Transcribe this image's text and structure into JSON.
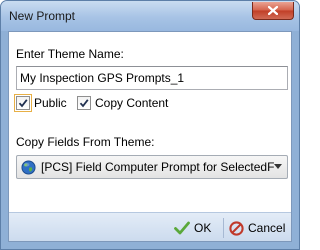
{
  "window": {
    "title": "New Prompt",
    "close_icon": "close-x-icon"
  },
  "form": {
    "theme_name_label": "Enter Theme Name:",
    "theme_name_value": "My Inspection GPS Prompts_1",
    "public_label": "Public",
    "public_checked": true,
    "copy_content_label": "Copy Content",
    "copy_content_checked": true,
    "copy_fields_label": "Copy Fields From Theme:",
    "copy_fields_selected": "[PCS] Field Computer Prompt for SelectedF",
    "combo_icon": "globe-icon"
  },
  "footer": {
    "ok_label": "OK",
    "cancel_label": "Cancel"
  },
  "colors": {
    "frame": "#8fb0d6",
    "ok_check": "#5aa83a",
    "cancel_icon": "#c0392b",
    "close_button": "#d4614a"
  }
}
